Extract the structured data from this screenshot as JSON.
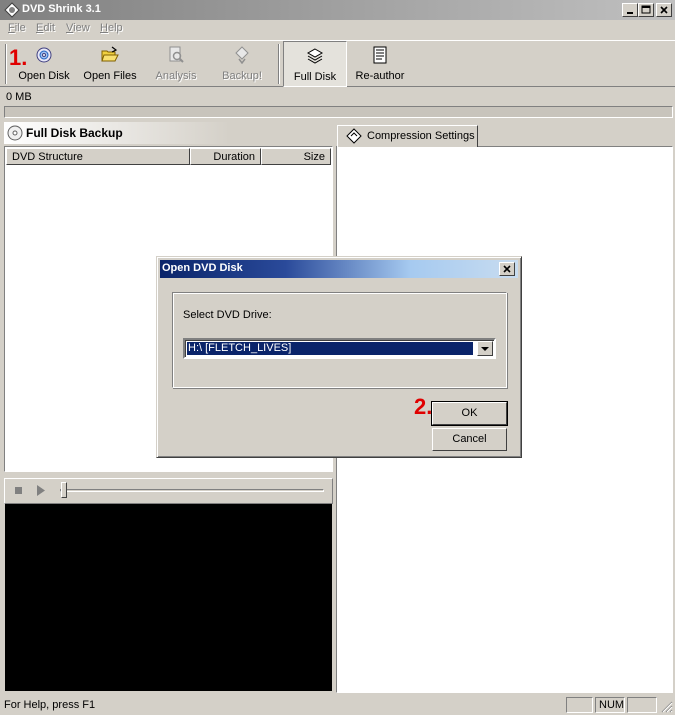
{
  "window": {
    "title": "DVD Shrink 3.1"
  },
  "menu": {
    "items": [
      "File",
      "Edit",
      "View",
      "Help"
    ]
  },
  "toolbar": {
    "open_disk": "Open Disk",
    "open_files": "Open Files",
    "analysis": "Analysis",
    "backup": "Backup!",
    "full_disk": "Full Disk",
    "re_author": "Re-author"
  },
  "annotations": {
    "step1": "1.",
    "step2": "2."
  },
  "size_readout": "0 MB",
  "progress_percent": 0,
  "left_pane": {
    "title": "Full Disk Backup",
    "columns": [
      "DVD Structure",
      "Duration",
      "Size"
    ]
  },
  "right_pane": {
    "tab_label": "Compression Settings"
  },
  "dialog": {
    "title": "Open DVD Disk",
    "label": "Select DVD Drive:",
    "selected_drive": "H:\\ [FLETCH_LIVES]",
    "ok": "OK",
    "cancel": "Cancel"
  },
  "status": {
    "help_text": "For Help, press F1",
    "num": "NUM"
  },
  "colors": {
    "title_active": "#0a246a",
    "marker": "#e00000",
    "face": "#d4d0c8"
  }
}
